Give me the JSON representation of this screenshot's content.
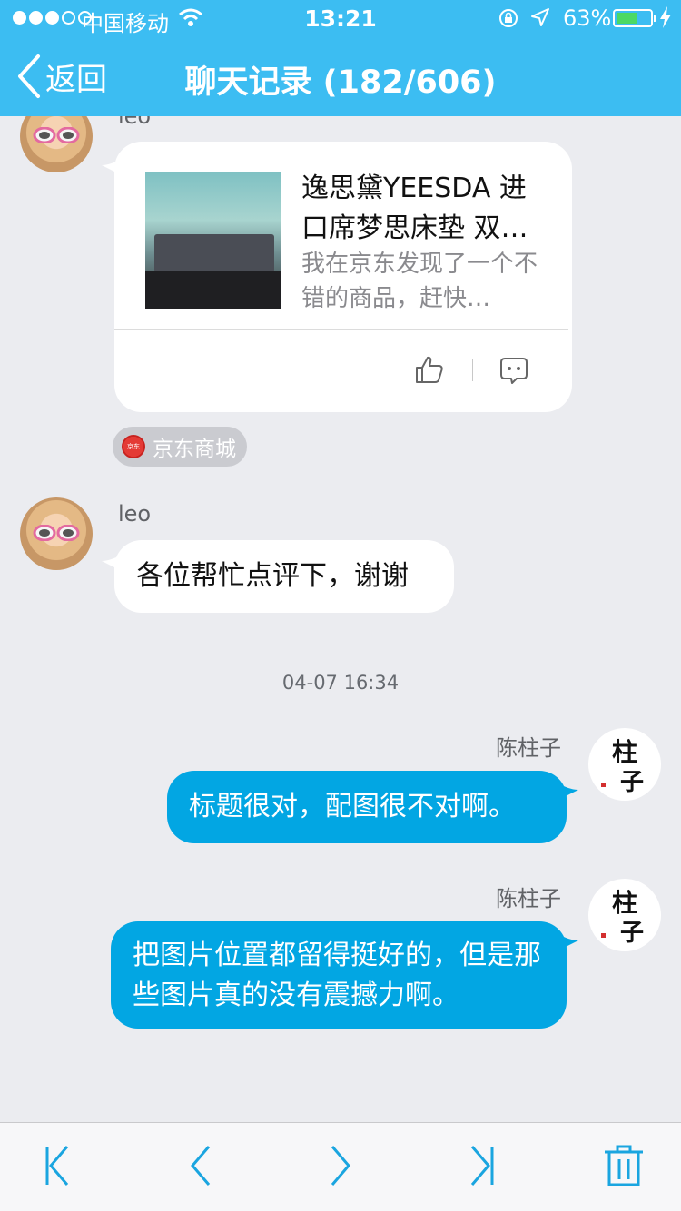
{
  "status_bar": {
    "carrier": "中国移动",
    "time": "13:21",
    "battery_percent": "63%",
    "battery_level": 0.63
  },
  "nav": {
    "back_label": "返回",
    "title": "聊天记录 (182/606)"
  },
  "messages": [
    {
      "sender": "leo",
      "type": "card",
      "card": {
        "title": "逸思黛YEESDA 进口席梦思床垫 双…",
        "description": "我在京东发现了一个不错的商品，赶快…"
      },
      "source": {
        "label": "京东商城",
        "logo_text": "京东"
      }
    },
    {
      "sender": "leo",
      "type": "text",
      "text": "各位帮忙点评下，谢谢"
    },
    {
      "type": "timestamp",
      "text": "04-07 16:34"
    },
    {
      "sender": "陈柱子",
      "type": "text",
      "text": "标题很对，配图很不对啊。"
    },
    {
      "sender": "陈柱子",
      "type": "text",
      "text": "把图片位置都留得挺好的，但是那些图片真的没有震撼力啊。"
    }
  ],
  "avatar_text": {
    "zhu": "柱子"
  },
  "colors": {
    "nav_bar": "#3cbdf2",
    "outgoing_bubble": "#02a6e3",
    "incoming_bubble": "#ffffff",
    "background": "#ebecf0",
    "toolbar_icon": "#1aa5e0"
  },
  "toolbar": {
    "icons": [
      "first-page-icon",
      "previous-page-icon",
      "next-page-icon",
      "last-page-icon",
      "trash-icon"
    ]
  }
}
